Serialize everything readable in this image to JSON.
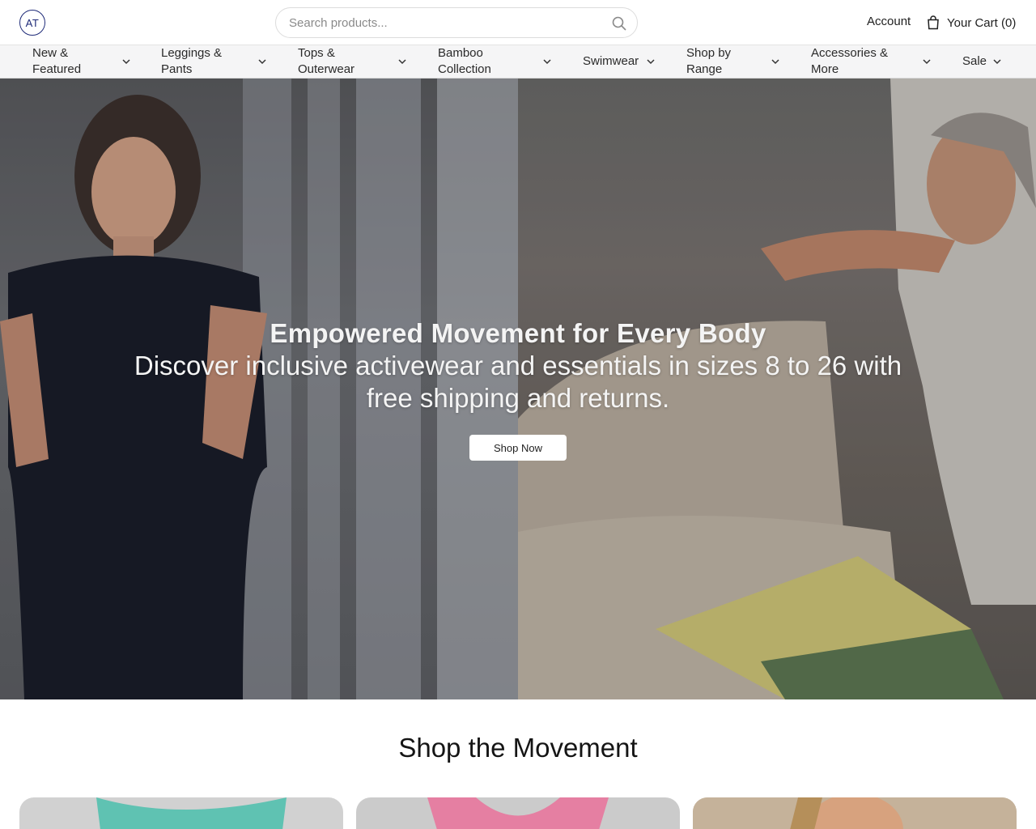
{
  "header": {
    "logo_text": "AT",
    "search_placeholder": "Search products...",
    "account_label": "Account",
    "cart_label": "Your Cart (0)",
    "icons": {
      "search": "search-icon",
      "cart": "bag-icon",
      "chevron": "chevron-down-icon"
    }
  },
  "nav": {
    "items": [
      {
        "label_line1": "New &",
        "label_line2": "Featured"
      },
      {
        "label_line1": "Leggings &",
        "label_line2": "Pants"
      },
      {
        "label_line1": "Tops &",
        "label_line2": "Outerwear"
      },
      {
        "label_line1": "Bamboo",
        "label_line2": "Collection"
      },
      {
        "label_line1": "Swimwear",
        "label_line2": ""
      },
      {
        "label_line1": "Shop by",
        "label_line2": "Range"
      },
      {
        "label_line1": "Accessories &",
        "label_line2": "More"
      },
      {
        "label_line1": "Sale",
        "label_line2": ""
      }
    ]
  },
  "hero": {
    "title": "Empowered Movement for Every Body",
    "subtitle": "Discover inclusive activewear and essentials in sizes 8 to 26 with free shipping and returns.",
    "cta_label": "Shop Now"
  },
  "section": {
    "title": "Shop the Movement",
    "cards": [
      {
        "color": "#5fc2b2"
      },
      {
        "color": "#e57fa2"
      },
      {
        "color": "#c7a987"
      }
    ]
  },
  "colors": {
    "brand": "#1e2a78",
    "nav_bg": "#f5f5f6",
    "text": "#1f1f1f"
  }
}
